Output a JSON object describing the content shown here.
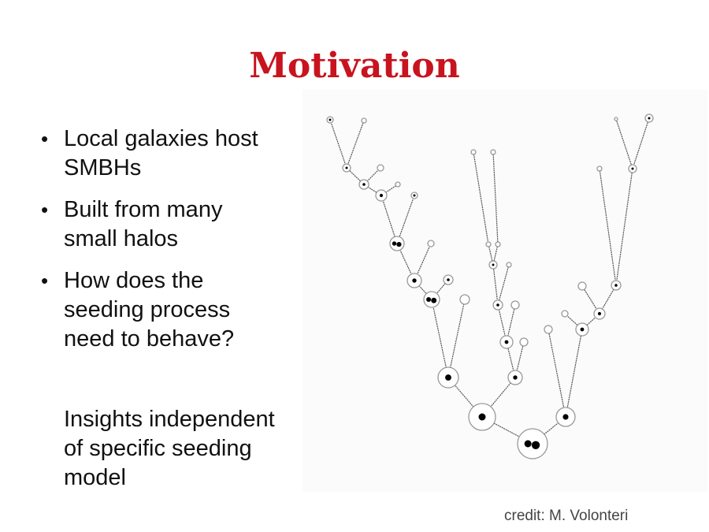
{
  "slide": {
    "title": "Motivation",
    "bullets": [
      {
        "line1": "Local galaxies host",
        "line2": "SMBHs",
        "line3": ""
      },
      {
        "line1": "Built from many",
        "line2": "small halos",
        "line3": ""
      },
      {
        "line1": "How does the",
        "line2": "seeding process",
        "line3": "need to behave?"
      }
    ],
    "note": [
      "Insights independent",
      "of specific seeding",
      "model"
    ],
    "figure_icon": "merger-tree-diagram",
    "credit": "credit: M. Volonteri"
  }
}
